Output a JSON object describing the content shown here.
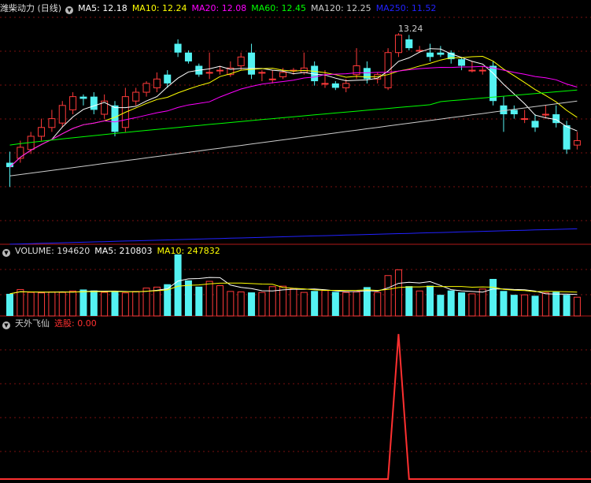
{
  "chart_data": [
    {
      "type": "candlestick",
      "title": "潍柴动力 (日线)",
      "ylim": [
        9.2,
        13.6
      ],
      "max_label": "13.24",
      "legend": [
        {
          "label": "MA5: 12.18",
          "color": "#ffffff"
        },
        {
          "label": "MA10: 12.24",
          "color": "#ffff00"
        },
        {
          "label": "MA20: 12.08",
          "color": "#ff00ff"
        },
        {
          "label": "MA60: 12.45",
          "color": "#00ff00"
        },
        {
          "label": "MA120: 12.25",
          "color": "#cccccc"
        },
        {
          "label": "MA250: 11.52",
          "color": "#2222ff"
        }
      ],
      "candles": [
        [
          10.3,
          10.2,
          10.55,
          9.75
        ],
        [
          10.4,
          10.65,
          10.8,
          10.3
        ],
        [
          10.6,
          10.9,
          11.0,
          10.5
        ],
        [
          10.9,
          11.1,
          11.3,
          10.8
        ],
        [
          11.1,
          11.3,
          11.5,
          11.0
        ],
        [
          11.2,
          11.6,
          11.7,
          11.1
        ],
        [
          11.5,
          11.8,
          11.9,
          11.4
        ],
        [
          11.8,
          11.75,
          11.85,
          11.6
        ],
        [
          11.8,
          11.5,
          11.9,
          11.4
        ],
        [
          11.4,
          11.7,
          11.85,
          11.3
        ],
        [
          11.6,
          11.0,
          11.7,
          10.9
        ],
        [
          11.1,
          11.8,
          12.0,
          11.0
        ],
        [
          11.7,
          11.9,
          12.0,
          11.6
        ],
        [
          11.9,
          12.1,
          12.15,
          11.8
        ],
        [
          12.0,
          12.2,
          12.35,
          11.9
        ],
        [
          12.3,
          12.1,
          12.4,
          12.0
        ],
        [
          13.0,
          12.8,
          13.1,
          12.7
        ],
        [
          12.8,
          12.6,
          12.85,
          12.55
        ],
        [
          12.5,
          12.3,
          12.55,
          12.25
        ],
        [
          12.35,
          12.35,
          12.8,
          12.2
        ],
        [
          12.4,
          12.4,
          12.5,
          12.3
        ],
        [
          12.3,
          12.45,
          12.6,
          12.25
        ],
        [
          12.5,
          12.7,
          12.8,
          12.4
        ],
        [
          12.8,
          12.3,
          13.0,
          12.2
        ],
        [
          12.35,
          12.35,
          12.4,
          12.15
        ],
        [
          12.2,
          12.2,
          12.4,
          12.1
        ],
        [
          12.25,
          12.35,
          12.45,
          12.2
        ],
        [
          12.4,
          12.4,
          12.45,
          12.3
        ],
        [
          12.35,
          12.45,
          12.8,
          12.3
        ],
        [
          12.5,
          12.15,
          12.6,
          12.05
        ],
        [
          12.1,
          12.1,
          12.4,
          12.0
        ],
        [
          12.1,
          12.0,
          12.15,
          11.95
        ],
        [
          12.0,
          12.1,
          12.2,
          11.9
        ],
        [
          12.3,
          12.5,
          12.9,
          12.2
        ],
        [
          12.45,
          12.2,
          12.6,
          12.1
        ],
        [
          12.2,
          12.3,
          12.35,
          12.1
        ],
        [
          12.0,
          12.8,
          12.9,
          11.95
        ],
        [
          12.8,
          13.2,
          13.24,
          12.7
        ],
        [
          13.1,
          12.9,
          13.2,
          12.85
        ],
        [
          12.85,
          12.85,
          12.95,
          12.8
        ],
        [
          12.8,
          12.7,
          13.0,
          12.6
        ],
        [
          12.8,
          12.75,
          12.95,
          12.7
        ],
        [
          12.8,
          12.65,
          12.85,
          12.55
        ],
        [
          12.65,
          12.5,
          12.7,
          12.4
        ],
        [
          12.4,
          12.4,
          12.6,
          12.35
        ],
        [
          12.4,
          12.4,
          12.5,
          12.3
        ],
        [
          12.5,
          11.7,
          12.6,
          11.6
        ],
        [
          11.6,
          11.4,
          11.8,
          11.0
        ],
        [
          11.5,
          11.4,
          11.6,
          11.3
        ],
        [
          11.3,
          11.3,
          11.5,
          11.2
        ],
        [
          11.25,
          11.1,
          11.4,
          11.0
        ],
        [
          11.4,
          11.4,
          11.6,
          11.3
        ],
        [
          11.4,
          11.2,
          11.6,
          11.1
        ],
        [
          11.15,
          10.6,
          11.25,
          10.5
        ],
        [
          10.7,
          10.8,
          11.0,
          10.6
        ]
      ]
    },
    {
      "type": "bar",
      "title": "VOLUME",
      "legend": [
        {
          "label": "VOLUME: 194620",
          "color": "#dddddd"
        },
        {
          "label": "MA5: 210803",
          "color": "#ffffff"
        },
        {
          "label": "MA10: 247832",
          "color": "#ffff00"
        }
      ],
      "values": [
        230000,
        275000,
        245000,
        240000,
        250000,
        245000,
        260000,
        275000,
        265000,
        245000,
        250000,
        240000,
        255000,
        290000,
        300000,
        330000,
        640000,
        370000,
        305000,
        360000,
        315000,
        255000,
        250000,
        245000,
        245000,
        305000,
        310000,
        285000,
        245000,
        260000,
        265000,
        250000,
        245000,
        250000,
        300000,
        245000,
        420000,
        480000,
        310000,
        260000,
        315000,
        220000,
        265000,
        245000,
        230000,
        280000,
        385000,
        260000,
        220000,
        220000,
        210000,
        240000,
        250000,
        220000,
        195000
      ],
      "ylim": [
        0,
        680000
      ]
    },
    {
      "type": "line",
      "title": "天外飞仙",
      "legend": [
        {
          "label": "天外飞仙",
          "color": "#cccccc"
        },
        {
          "label": "选股: 0.00",
          "color": "#ff3030"
        }
      ],
      "values": [
        0,
        0,
        0,
        0,
        0,
        0,
        0,
        0,
        0,
        0,
        0,
        0,
        0,
        0,
        0,
        0,
        0,
        0,
        0,
        0,
        0,
        0,
        0,
        0,
        0,
        0,
        0,
        0,
        0,
        0,
        0,
        0,
        0,
        0,
        0,
        0,
        0,
        1,
        0,
        0,
        0,
        0,
        0,
        0,
        0,
        0,
        0,
        0,
        0,
        0,
        0,
        0,
        0,
        0,
        0
      ],
      "ylim": [
        0,
        1
      ]
    }
  ]
}
